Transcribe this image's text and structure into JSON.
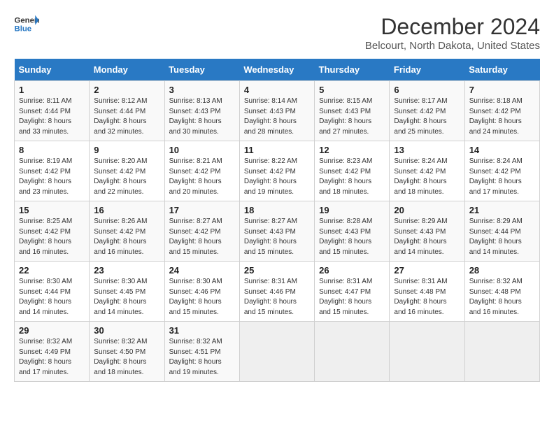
{
  "logo": {
    "line1": "General",
    "line2": "Blue"
  },
  "title": "December 2024",
  "location": "Belcourt, North Dakota, United States",
  "weekdays": [
    "Sunday",
    "Monday",
    "Tuesday",
    "Wednesday",
    "Thursday",
    "Friday",
    "Saturday"
  ],
  "weeks": [
    [
      {
        "day": "1",
        "info": "Sunrise: 8:11 AM\nSunset: 4:44 PM\nDaylight: 8 hours\nand 33 minutes."
      },
      {
        "day": "2",
        "info": "Sunrise: 8:12 AM\nSunset: 4:44 PM\nDaylight: 8 hours\nand 32 minutes."
      },
      {
        "day": "3",
        "info": "Sunrise: 8:13 AM\nSunset: 4:43 PM\nDaylight: 8 hours\nand 30 minutes."
      },
      {
        "day": "4",
        "info": "Sunrise: 8:14 AM\nSunset: 4:43 PM\nDaylight: 8 hours\nand 28 minutes."
      },
      {
        "day": "5",
        "info": "Sunrise: 8:15 AM\nSunset: 4:43 PM\nDaylight: 8 hours\nand 27 minutes."
      },
      {
        "day": "6",
        "info": "Sunrise: 8:17 AM\nSunset: 4:42 PM\nDaylight: 8 hours\nand 25 minutes."
      },
      {
        "day": "7",
        "info": "Sunrise: 8:18 AM\nSunset: 4:42 PM\nDaylight: 8 hours\nand 24 minutes."
      }
    ],
    [
      {
        "day": "8",
        "info": "Sunrise: 8:19 AM\nSunset: 4:42 PM\nDaylight: 8 hours\nand 23 minutes."
      },
      {
        "day": "9",
        "info": "Sunrise: 8:20 AM\nSunset: 4:42 PM\nDaylight: 8 hours\nand 22 minutes."
      },
      {
        "day": "10",
        "info": "Sunrise: 8:21 AM\nSunset: 4:42 PM\nDaylight: 8 hours\nand 20 minutes."
      },
      {
        "day": "11",
        "info": "Sunrise: 8:22 AM\nSunset: 4:42 PM\nDaylight: 8 hours\nand 19 minutes."
      },
      {
        "day": "12",
        "info": "Sunrise: 8:23 AM\nSunset: 4:42 PM\nDaylight: 8 hours\nand 18 minutes."
      },
      {
        "day": "13",
        "info": "Sunrise: 8:24 AM\nSunset: 4:42 PM\nDaylight: 8 hours\nand 18 minutes."
      },
      {
        "day": "14",
        "info": "Sunrise: 8:24 AM\nSunset: 4:42 PM\nDaylight: 8 hours\nand 17 minutes."
      }
    ],
    [
      {
        "day": "15",
        "info": "Sunrise: 8:25 AM\nSunset: 4:42 PM\nDaylight: 8 hours\nand 16 minutes."
      },
      {
        "day": "16",
        "info": "Sunrise: 8:26 AM\nSunset: 4:42 PM\nDaylight: 8 hours\nand 16 minutes."
      },
      {
        "day": "17",
        "info": "Sunrise: 8:27 AM\nSunset: 4:42 PM\nDaylight: 8 hours\nand 15 minutes."
      },
      {
        "day": "18",
        "info": "Sunrise: 8:27 AM\nSunset: 4:43 PM\nDaylight: 8 hours\nand 15 minutes."
      },
      {
        "day": "19",
        "info": "Sunrise: 8:28 AM\nSunset: 4:43 PM\nDaylight: 8 hours\nand 15 minutes."
      },
      {
        "day": "20",
        "info": "Sunrise: 8:29 AM\nSunset: 4:43 PM\nDaylight: 8 hours\nand 14 minutes."
      },
      {
        "day": "21",
        "info": "Sunrise: 8:29 AM\nSunset: 4:44 PM\nDaylight: 8 hours\nand 14 minutes."
      }
    ],
    [
      {
        "day": "22",
        "info": "Sunrise: 8:30 AM\nSunset: 4:44 PM\nDaylight: 8 hours\nand 14 minutes."
      },
      {
        "day": "23",
        "info": "Sunrise: 8:30 AM\nSunset: 4:45 PM\nDaylight: 8 hours\nand 14 minutes."
      },
      {
        "day": "24",
        "info": "Sunrise: 8:30 AM\nSunset: 4:46 PM\nDaylight: 8 hours\nand 15 minutes."
      },
      {
        "day": "25",
        "info": "Sunrise: 8:31 AM\nSunset: 4:46 PM\nDaylight: 8 hours\nand 15 minutes."
      },
      {
        "day": "26",
        "info": "Sunrise: 8:31 AM\nSunset: 4:47 PM\nDaylight: 8 hours\nand 15 minutes."
      },
      {
        "day": "27",
        "info": "Sunrise: 8:31 AM\nSunset: 4:48 PM\nDaylight: 8 hours\nand 16 minutes."
      },
      {
        "day": "28",
        "info": "Sunrise: 8:32 AM\nSunset: 4:48 PM\nDaylight: 8 hours\nand 16 minutes."
      }
    ],
    [
      {
        "day": "29",
        "info": "Sunrise: 8:32 AM\nSunset: 4:49 PM\nDaylight: 8 hours\nand 17 minutes."
      },
      {
        "day": "30",
        "info": "Sunrise: 8:32 AM\nSunset: 4:50 PM\nDaylight: 8 hours\nand 18 minutes."
      },
      {
        "day": "31",
        "info": "Sunrise: 8:32 AM\nSunset: 4:51 PM\nDaylight: 8 hours\nand 19 minutes."
      },
      {
        "day": "",
        "info": ""
      },
      {
        "day": "",
        "info": ""
      },
      {
        "day": "",
        "info": ""
      },
      {
        "day": "",
        "info": ""
      }
    ]
  ]
}
